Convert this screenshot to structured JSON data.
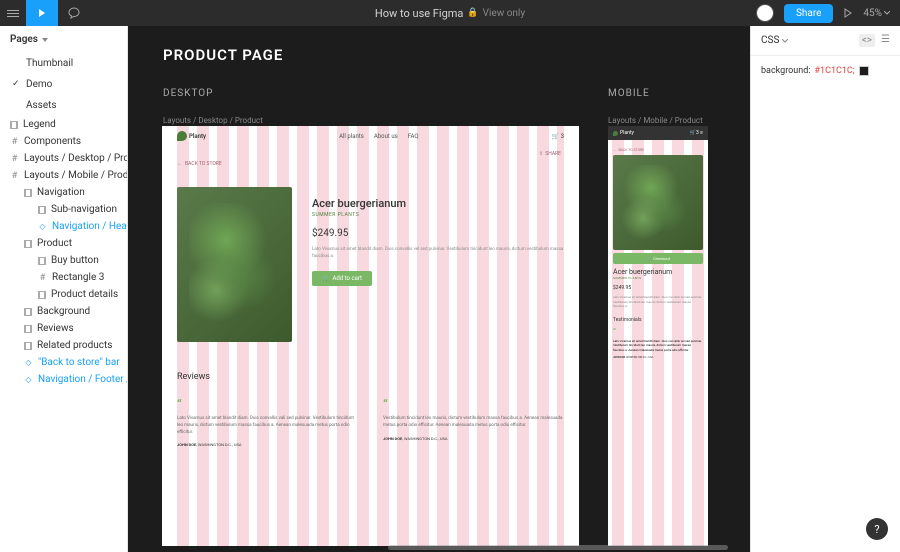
{
  "topbar": {
    "title": "How to use Figma",
    "view_only": "View only",
    "share": "Share",
    "zoom": "45%"
  },
  "sidebar": {
    "pages_label": "Pages",
    "pages": [
      "Thumbnail",
      "Demo",
      "Assets"
    ],
    "layers": [
      {
        "label": "Legend",
        "lvl": "l1",
        "ic": "rect"
      },
      {
        "label": "Components",
        "lvl": "l1",
        "ic": "hash"
      },
      {
        "label": "Layouts / Desktop / Product",
        "lvl": "l1",
        "ic": "hash"
      },
      {
        "label": "Layouts / Mobile / Product",
        "lvl": "l1",
        "ic": "hash"
      },
      {
        "label": "Navigation",
        "lvl": "l2",
        "ic": "rect"
      },
      {
        "label": "Sub-navigation",
        "lvl": "l3",
        "ic": "rect"
      },
      {
        "label": "Navigation / Head…",
        "lvl": "l3",
        "ic": "diamond",
        "sel": true
      },
      {
        "label": "Product",
        "lvl": "l2",
        "ic": "rect"
      },
      {
        "label": "Buy button",
        "lvl": "l3",
        "ic": "rect"
      },
      {
        "label": "Rectangle 3",
        "lvl": "l3",
        "ic": "frame"
      },
      {
        "label": "Product details",
        "lvl": "l3",
        "ic": "rect"
      },
      {
        "label": "Background",
        "lvl": "l2",
        "ic": "rect"
      },
      {
        "label": "Reviews",
        "lvl": "l2",
        "ic": "rect"
      },
      {
        "label": "Related products",
        "lvl": "l2",
        "ic": "rect"
      },
      {
        "label": "\"Back to store\" bar",
        "lvl": "l2",
        "ic": "diamond",
        "sel": true
      },
      {
        "label": "Navigation / Footer / …",
        "lvl": "l2",
        "ic": "diamond",
        "sel": true
      }
    ]
  },
  "canvas": {
    "title": "PRODUCT PAGE",
    "desktop_label": "DESKTOP",
    "mobile_label": "MOBILE",
    "desktop_frame": "Layouts / Desktop / Product",
    "mobile_frame": "Layouts / Mobile / Product"
  },
  "design": {
    "brand": "Planty",
    "nav": [
      "All plants",
      "About us",
      "FAQ"
    ],
    "cart_count": "3",
    "back": "BACK TO STORE",
    "share": "SHARE",
    "product_name": "Acer buergerianum",
    "category": "SUMMER PLANTS",
    "price": "$249.95",
    "desc": "Lato Vivamus sit amet blandit diam. Duis convallis vel  sed pulvinar. Vestibulum tincidunt leo mauris, dictum vestibulum massa faucibus a.",
    "add_cart": "Add to cart",
    "checkout": "Checkout",
    "reviews_h": "Reviews",
    "testimonials_h": "Testimonials",
    "rev1": "Lato Vivamus sit amet blandit diam. Duis convallis vali sed pulvinar. Vestibulum tincidunt leo mauris, dictum vestibulum massa faucibus a. Aenean malesuada metus porta odio efficitur.",
    "rev2": "Vestibulum tincidunt leo mauris, dictum vestibulum massa faucibus a. Aenean malesuada metus porta odio efficitur. Aenean malesuada metus porta odio efficitur.",
    "rev_mobile": "Lato Vivamus sit amet blandit diam. Duis convallis vel sed pulvinar. Vestibulum tincidunt leo mauris, dictum vestibulum massa faucibus a. Aenean malesuada metus porta odio efficitur.",
    "author": "JOHN DOE",
    "author_loc": ", WASHINGTON D.C., USA"
  },
  "inspect": {
    "lang": "CSS",
    "prop": "background:",
    "val": "#1C1C1C;"
  }
}
